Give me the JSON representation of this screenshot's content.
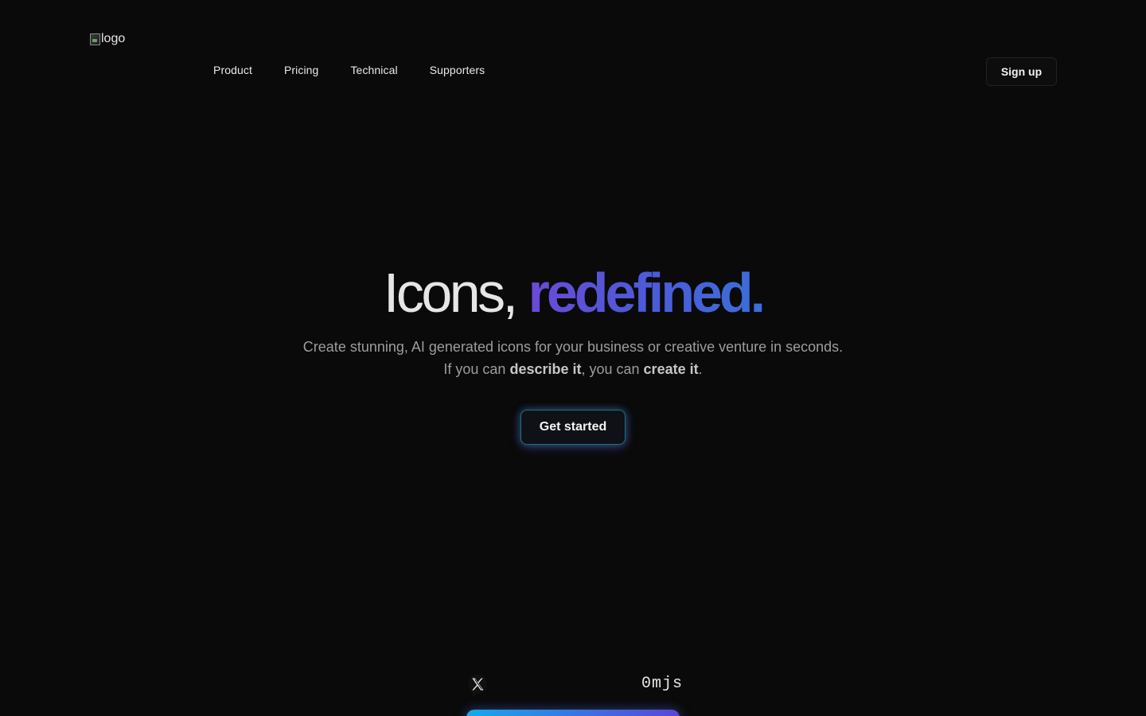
{
  "header": {
    "logo_alt": "logo",
    "nav": [
      {
        "label": "Product"
      },
      {
        "label": "Pricing"
      },
      {
        "label": "Technical"
      },
      {
        "label": "Supporters"
      }
    ],
    "signup_label": "Sign up"
  },
  "hero": {
    "title_plain": "Icons, ",
    "title_accent": "redefined.",
    "subtitle_line1": "Create stunning, AI generated icons for your business or creative venture in seconds.",
    "subtitle_line2_a": "If you can ",
    "subtitle_line2_b": "describe it",
    "subtitle_line2_c": ", you can ",
    "subtitle_line2_d": "create it",
    "subtitle_line2_e": ".",
    "cta_label": "Get started"
  },
  "footer": {
    "social_icon": "x-icon",
    "counter_text": "0mjs"
  },
  "colors": {
    "background": "#0a0a0a",
    "accent_start": "#6a4ad6",
    "accent_end": "#3a6fd8",
    "bar_start": "#18a8e6",
    "bar_end": "#5b46d6"
  }
}
